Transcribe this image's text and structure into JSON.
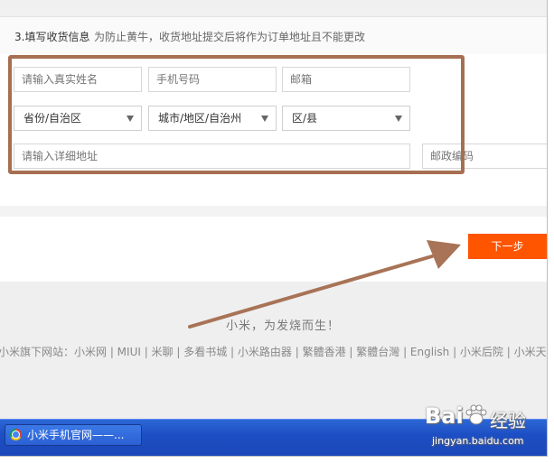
{
  "section": {
    "title": "3.填写收货信息",
    "note": "为防止黄牛，收货地址提交后将作为订单地址且不能更改"
  },
  "form": {
    "name_placeholder": "请输入真实姓名",
    "phone_placeholder": "手机号码",
    "email_placeholder": "邮箱",
    "province_value": "省份/自治区",
    "city_value": "城市/地区/自治州",
    "district_value": "区/县",
    "address_placeholder": "请输入详细地址",
    "postcode_placeholder": "邮政编码"
  },
  "next_button": {
    "label": "下一步"
  },
  "footer": {
    "slogan": "小米，为发烧而生！",
    "links": "小米旗下网站：小米网 | MIUI | 米聊 | 多看书城 | 小米路由器 | 繁體香港 | 繁體台灣 | English | 小米后院 | 小米天猫店 | 小米"
  },
  "taskbar": {
    "window_title": "小米手机官网——..."
  },
  "watermark": {
    "logo": "Bai",
    "logo2": "经验",
    "url": "jingyan.baidu.com"
  },
  "colors": {
    "accent": "#ff5400",
    "highlight": "#a76f52",
    "taskbar": "#245edb"
  }
}
